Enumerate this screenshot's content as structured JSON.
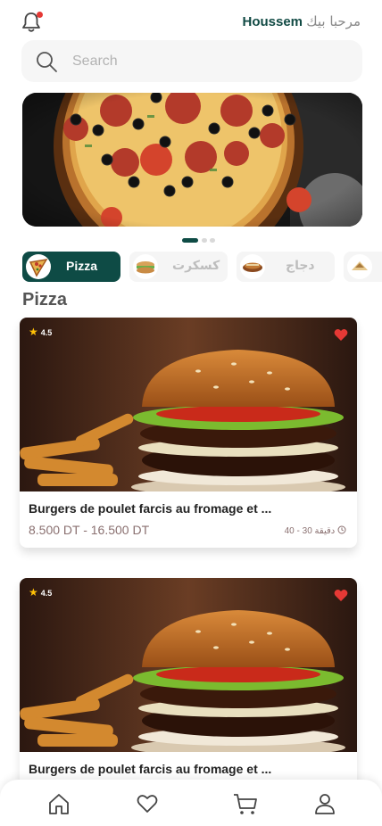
{
  "header": {
    "greeting": "مرحبا بيك",
    "user_name": "Houssem",
    "notification_icon": "bell-icon",
    "notification_dot_color": "#e53935"
  },
  "search": {
    "placeholder": "Search",
    "icon": "search-icon"
  },
  "banner": {
    "image": "pizza-photo",
    "slides": 3,
    "active_slide": 0
  },
  "categories": [
    {
      "label": "Pizza",
      "icon": "pizza-slice",
      "active": true
    },
    {
      "label": "كسكرت",
      "icon": "sandwich",
      "active": false
    },
    {
      "label": "دجاج",
      "icon": "chicken",
      "active": false
    },
    {
      "label": "",
      "icon": "wrap",
      "active": false
    }
  ],
  "section_title": "Pizza",
  "products": [
    {
      "rating": "4.5",
      "title": "Burgers de poulet farcis au fromage et ...",
      "price": "8.500 DT - 16.500 DT",
      "time_range": "30 - 40",
      "time_unit": "دقيقة",
      "favorite": true,
      "image": "burger-photo"
    },
    {
      "rating": "4.5",
      "title": "Burgers de poulet farcis au fromage et ...",
      "favorite": true,
      "image": "burger-photo"
    }
  ],
  "bottom_nav": [
    "home-icon",
    "heart-icon",
    "cart-icon",
    "profile-icon"
  ],
  "colors": {
    "primary": "#0e4b45",
    "favorite": "#e53935",
    "star": "#ffc107"
  }
}
